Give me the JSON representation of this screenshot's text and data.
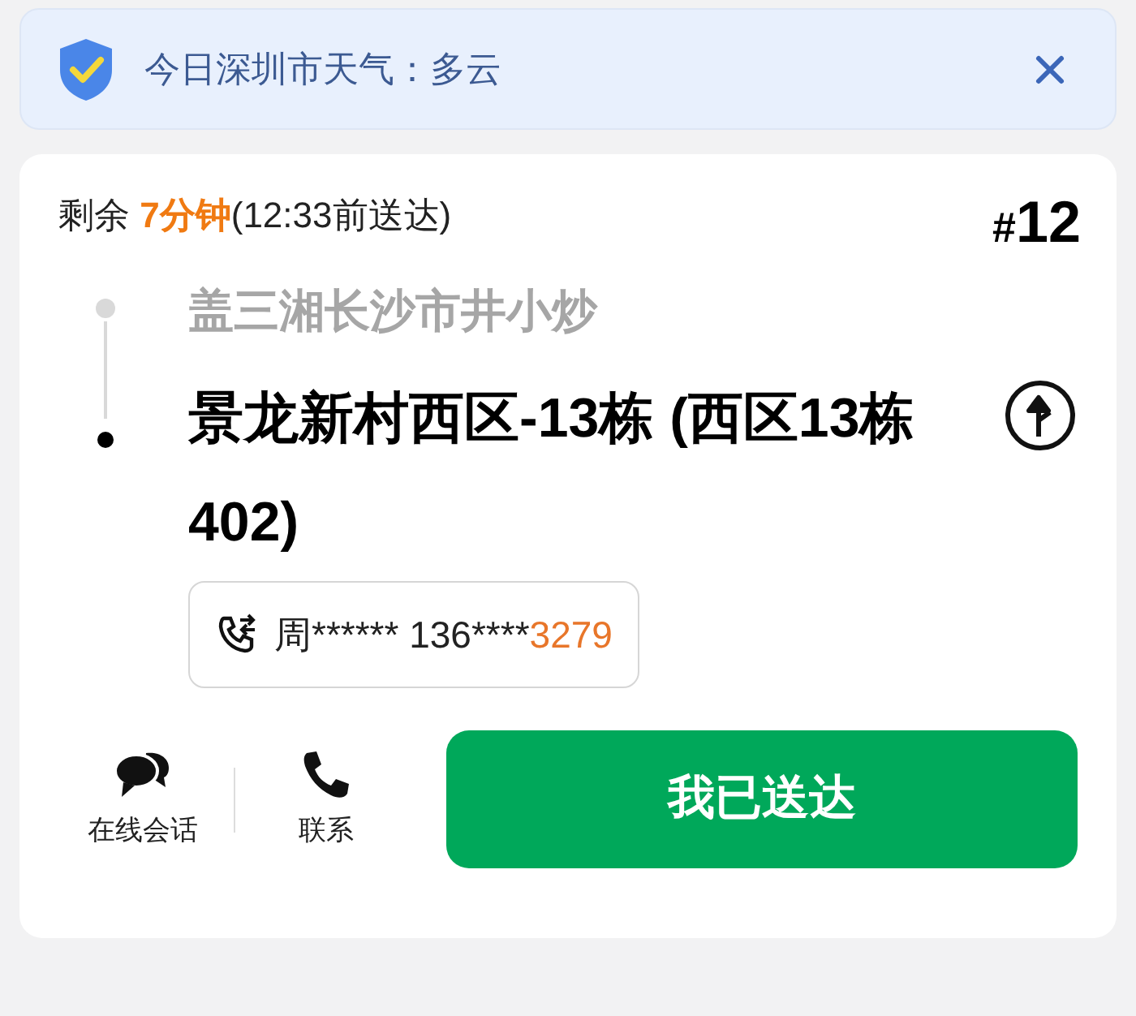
{
  "banner": {
    "text": "今日深圳市天气：多云"
  },
  "order": {
    "remaining_label": "剩余 ",
    "remaining_time": "7分钟",
    "deadline": "(12:33前送达)",
    "number_prefix": "#",
    "number": "12",
    "route": [
      {
        "kind": "pickup",
        "text": "盖三湘长沙市井小炒"
      },
      {
        "kind": "dropoff",
        "text": "景龙新村西区-13栋 (西区13栋402)"
      }
    ],
    "contact": {
      "name": "周******",
      "phone_masked": "136****",
      "phone_tail": "3279"
    }
  },
  "actions": [
    {
      "kind": "chat",
      "label": "在线会话"
    },
    {
      "kind": "call",
      "label": "联系"
    }
  ],
  "primary_button": "我已送达"
}
